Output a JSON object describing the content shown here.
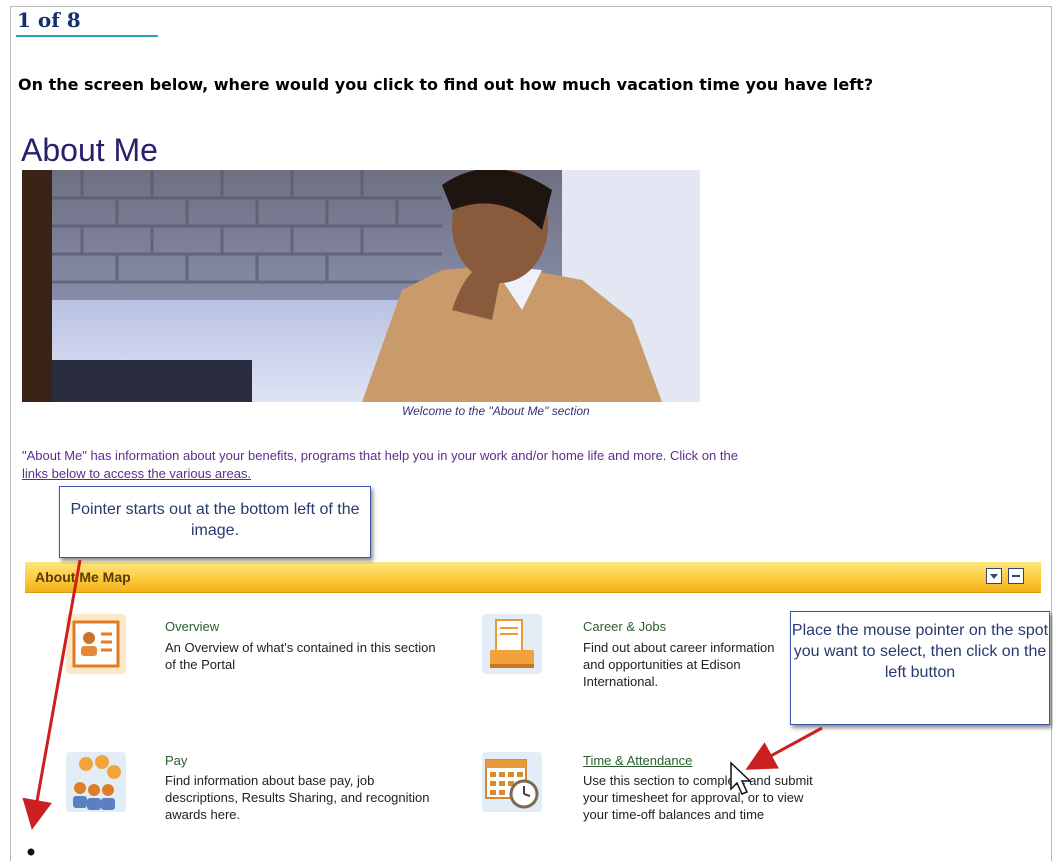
{
  "pager": "1 of 8",
  "question": "On the screen below, where would you click to find out how much vacation time you have left?",
  "page_title": "About Me",
  "hero_caption": "Welcome to the \"About Me\" section",
  "intro_text": "\"About Me\" has information about your benefits, programs that help you in your work and/or home life and more. Click on the",
  "intro_link": "links below to access the various areas.",
  "callout_pointer": "Pointer starts out at the bottom left of the image.",
  "callout_instruction": "Place the mouse pointer on the spot you want to select, then click on the left button",
  "map_title": "About Me Map",
  "items": [
    {
      "title": "Overview",
      "desc": "An Overview of what's contained in this section of the Portal"
    },
    {
      "title": "Career & Jobs",
      "desc": "Find out about career information and opportunities at Edison International."
    },
    {
      "title": "Pay",
      "desc": "Find information about base pay, job descriptions, Results Sharing, and recognition awards here."
    },
    {
      "title": "Time & Attendance",
      "desc": "Use this section to complete and submit your timesheet for approval, or to view your time-off balances and time"
    }
  ],
  "icons": [
    "overview-icon",
    "career-icon",
    "pay-icon",
    "calendar-clock-icon"
  ],
  "colors": {
    "map_bar": "#fcc83a",
    "title": "#26206d",
    "arrow": "#cc1f1f",
    "link_green": "#2b5d2d"
  }
}
